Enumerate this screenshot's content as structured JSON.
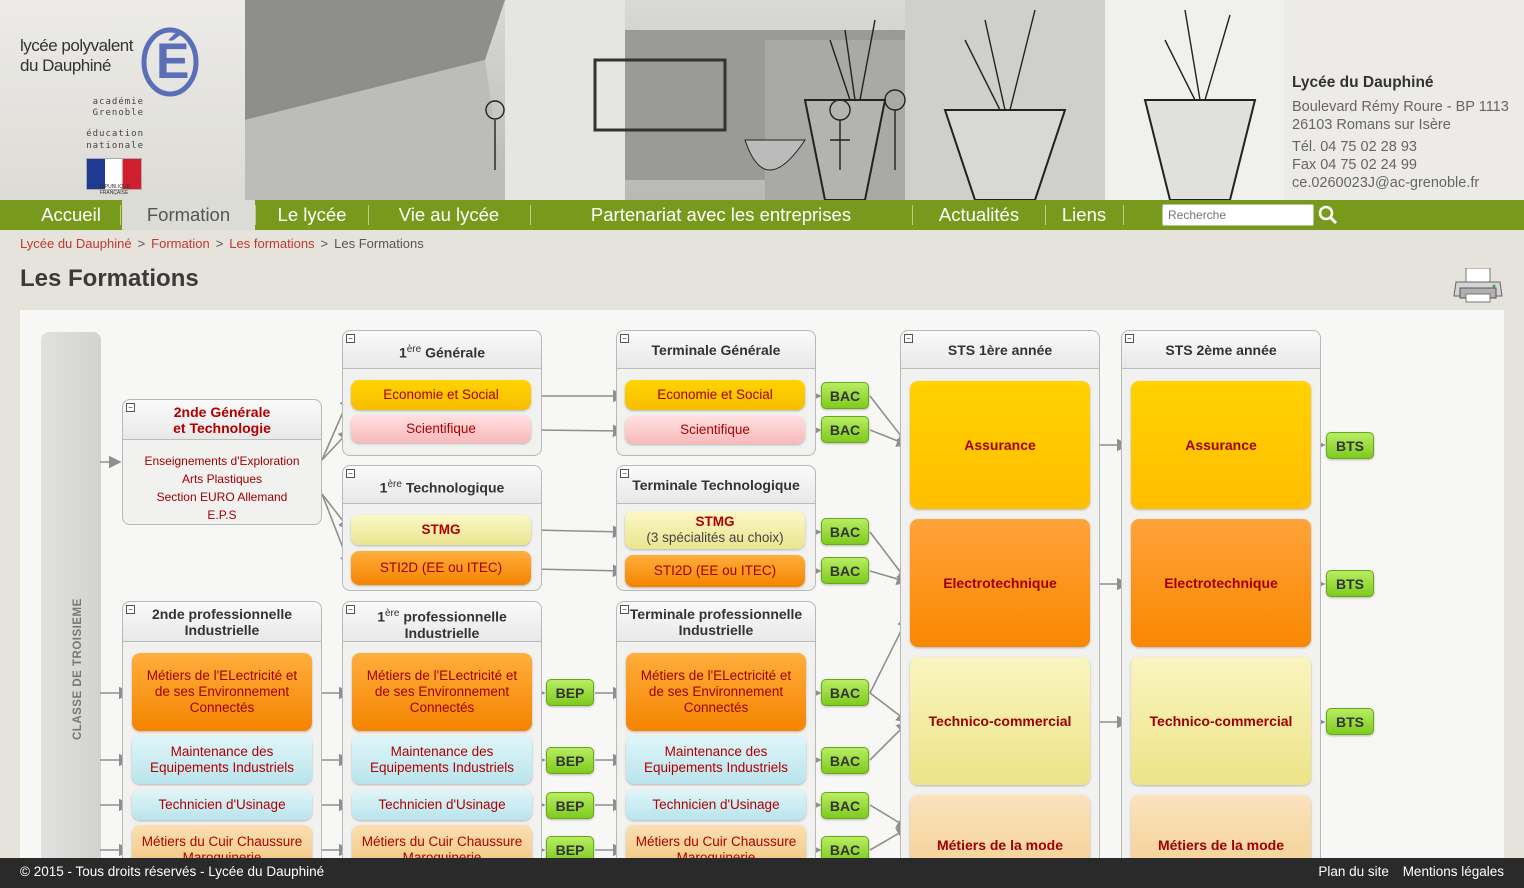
{
  "header": {
    "logo": {
      "line1": "lycée polyvalent",
      "line2": "du Dauphiné",
      "academie": "académie",
      "academie_name": "Grenoble",
      "education1": "éducation",
      "education2": "nationale",
      "republique": "RÉPUBLIQUE FRANÇAISE",
      "logo_letter": "É"
    },
    "address": {
      "name": "Lycée du Dauphiné",
      "street": "Boulevard Rémy Roure - BP 1113",
      "city": "26103 Romans sur Isère",
      "tel": "Tél. 04 75 02 28 93",
      "fax": "Fax 04 75 02 24 99",
      "email": "ce.0260023J@ac-grenoble.fr"
    }
  },
  "nav": {
    "items": [
      "Accueil",
      "Formation",
      "Le lycée",
      "Vie au lycée",
      "Partenariat avec les entreprises",
      "Actualités",
      "Liens"
    ],
    "active": "Formation",
    "search_placeholder": "Recherche"
  },
  "breadcrumb": [
    "Lycée du Dauphiné",
    "Formation",
    "Les formations",
    "Les Formations"
  ],
  "page_title": "Les Formations",
  "chart": {
    "troisieme": "CLASSE DE TROISIEME",
    "panels": {
      "premiere_generale": {
        "sup": "ère",
        "pre": "1",
        "title": "Générale"
      },
      "terminale_generale": "Terminale Générale",
      "premiere_techno": {
        "pre": "1",
        "sup": "ère",
        "title": "Technologique"
      },
      "terminale_techno": "Terminale Technologique",
      "seconde_gt": {
        "line1": "2nde Générale",
        "line2": "et Technologie"
      },
      "seconde_options": [
        "Enseignements d'Exploration",
        "Arts Plastiques",
        "Section EURO Allemand",
        "E.P.S"
      ],
      "seconde_pro": {
        "line1": "2nde professionnelle",
        "line2": "Industrielle"
      },
      "premiere_pro": {
        "pre": "1",
        "sup": "ère",
        "line1": "professionnelle",
        "line2": "Industrielle"
      },
      "terminale_pro": {
        "line1": "Terminale professionnelle",
        "line2": "Industrielle"
      },
      "sts1": "STS 1ère année",
      "sts2": "STS 2ème année"
    },
    "boxes": {
      "eco_social": "Economie et Social",
      "scientifique": "Scientifique",
      "stmg": "STMG",
      "stmg_choix": "(3 spécialités au choix)",
      "sti2d": "STI2D (EE ou ITEC)",
      "melec": "Métiers de l'ELectricité et de ses Environnement Connectés",
      "mei": "Maintenance des Equipements Industriels",
      "usinage": "Technicien d'Usinage",
      "cuir": "Métiers du Cuir Chaussure Maroquinerie",
      "assurance": "Assurance",
      "electrotechnique": "Electrotechnique",
      "technico": "Technico-commercial",
      "mode": "Métiers de la mode"
    },
    "badges": {
      "bac": "BAC",
      "bep": "BEP",
      "bts": "BTS"
    }
  },
  "footer": {
    "copyright": "© 2015 - Tous droits réservés - Lycée du Dauphiné",
    "links": [
      "Plan du site",
      "Mentions légales"
    ]
  },
  "colors": {
    "nav_green": "#789a1c",
    "link_red": "#c0392b",
    "badge_green": "#8fd435"
  }
}
